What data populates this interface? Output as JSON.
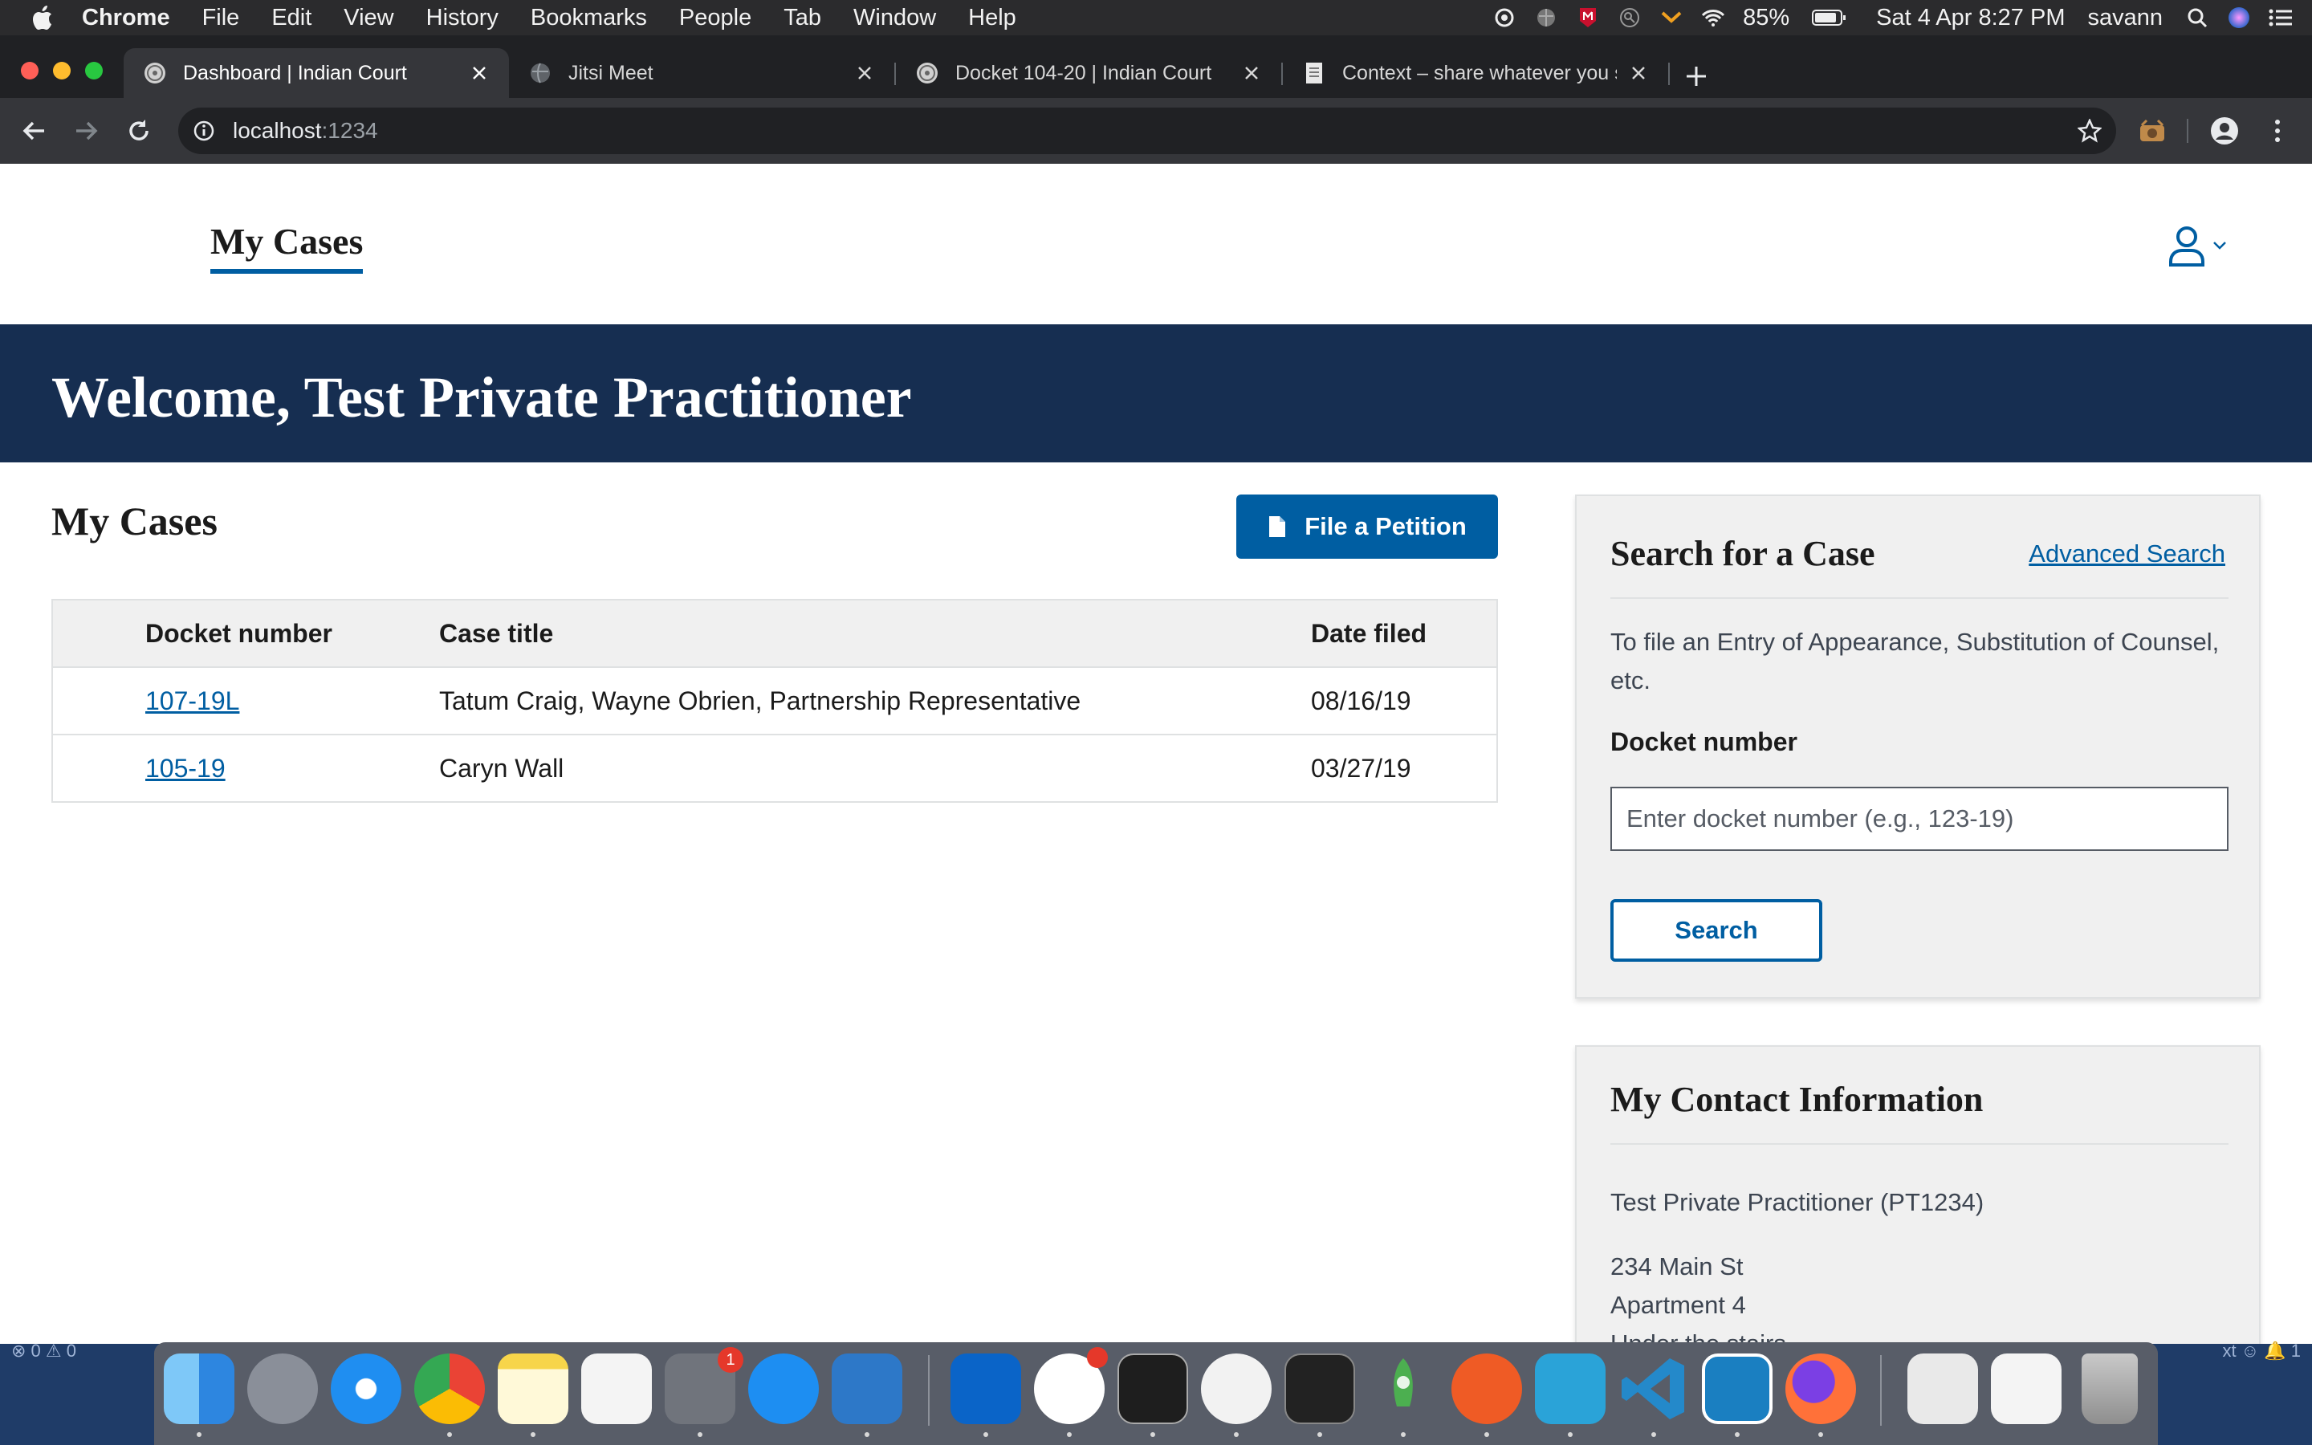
{
  "menubar": {
    "app_name": "Chrome",
    "items": [
      "File",
      "Edit",
      "View",
      "History",
      "Bookmarks",
      "People",
      "Tab",
      "Window",
      "Help"
    ],
    "battery": "85%",
    "datetime": "Sat 4 Apr  8:27 PM",
    "user": "savann"
  },
  "browser": {
    "tabs": [
      {
        "title": "Dashboard | Indian Court",
        "active": true,
        "favicon": "court-seal-icon"
      },
      {
        "title": "Jitsi Meet",
        "active": false,
        "favicon": "globe-icon"
      },
      {
        "title": "Docket 104-20 | Indian Court",
        "active": false,
        "favicon": "court-seal-icon"
      },
      {
        "title": "Context – share whatever you s",
        "active": false,
        "favicon": "document-icon"
      }
    ],
    "url_host": "localhost",
    "url_port": ":1234"
  },
  "page": {
    "nav": {
      "my_cases": "My Cases"
    },
    "banner": {
      "welcome": "Welcome, Test Private Practitioner"
    },
    "cases": {
      "title": "My Cases",
      "file_petition_label": "File a Petition",
      "columns": [
        "Docket number",
        "Case title",
        "Date filed"
      ],
      "rows": [
        {
          "docket": "107-19L",
          "title": "Tatum Craig, Wayne Obrien, Partnership Representative",
          "date": "08/16/19"
        },
        {
          "docket": "105-19",
          "title": "Caryn Wall",
          "date": "03/27/19"
        }
      ]
    },
    "search": {
      "title": "Search for a Case",
      "advanced_link": "Advanced Search",
      "help": "To file an Entry of Appearance, Substitution of Counsel, etc.",
      "field_label": "Docket number",
      "placeholder": "Enter docket number (e.g., 123-19)",
      "button": "Search"
    },
    "contact": {
      "title": "My Contact Information",
      "name": "Test Private Practitioner (PT1234)",
      "address1": "234 Main St",
      "address2": "Apartment 4",
      "address3": "Under the stairs"
    }
  },
  "dock": {
    "status_left": "⊗ 0 ⚠ 0",
    "status_right": "xt  ☺  🔔 1",
    "badges": {
      "system_preferences": "1"
    },
    "apps": [
      "finder",
      "launchpad",
      "safari",
      "chrome",
      "notes",
      "reminders",
      "system-preferences",
      "app-store",
      "teamviewer",
      "outlook",
      "slack",
      "terminal",
      "sequence",
      "activity-monitor",
      "rocket",
      "postman",
      "remote-upload",
      "vscode",
      "bracket-app",
      "firefox",
      "documents",
      "screenshot",
      "trash"
    ]
  },
  "colors": {
    "primary": "#005ea2",
    "banner": "#162e51",
    "panel": "#f0f0f0"
  }
}
